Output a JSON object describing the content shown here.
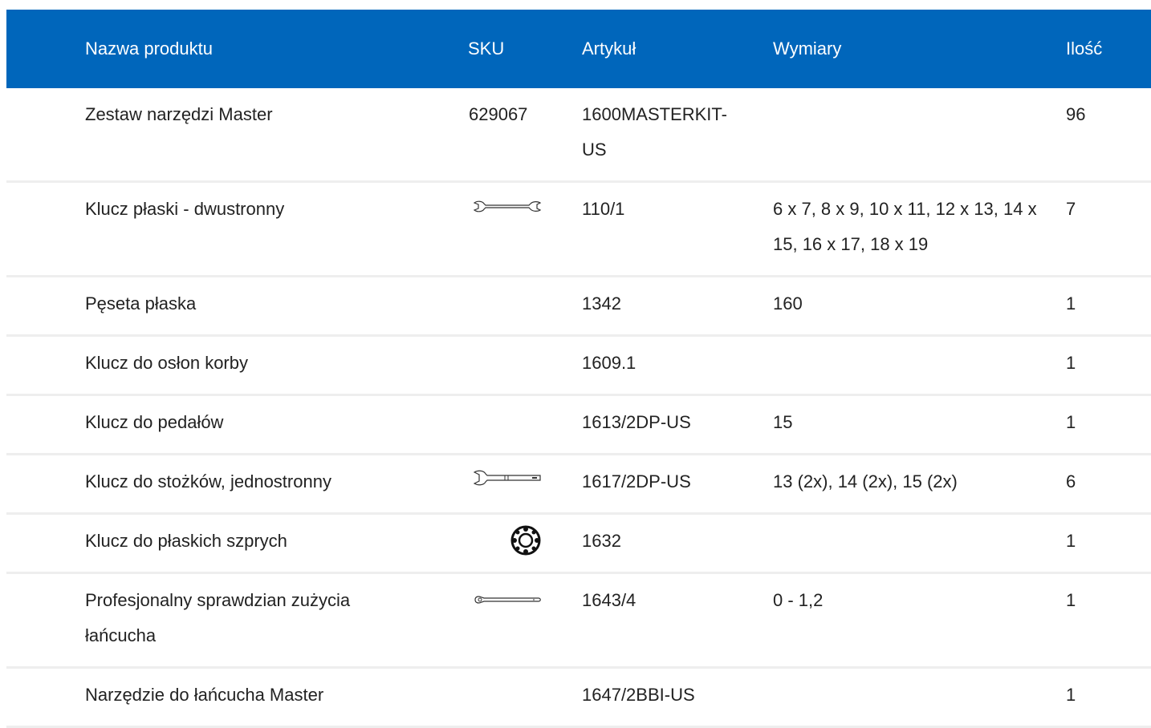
{
  "headers": {
    "name": "Nazwa produktu",
    "sku": "SKU",
    "article": "Artykuł",
    "dimensions": "Wymiary",
    "qty": "Ilość"
  },
  "rows": [
    {
      "name": "Zestaw narzędzi Master",
      "sku": "629067",
      "icon": "",
      "article": "1600MASTERKIT-US",
      "dimensions": "",
      "qty": "96"
    },
    {
      "name": "Klucz płaski - dwustronny",
      "sku": "",
      "icon": "double-open-wrench-icon",
      "article": "110/1",
      "dimensions": "6 x 7, 8 x 9, 10 x 11, 12 x 13, 14 x 15, 16 x 17, 18 x 19",
      "qty": "7"
    },
    {
      "name": "Pęseta płaska",
      "sku": "",
      "icon": "",
      "article": "1342",
      "dimensions": "160",
      "qty": "1"
    },
    {
      "name": "Klucz do osłon korby",
      "sku": "",
      "icon": "",
      "article": "1609.1",
      "dimensions": "",
      "qty": "1"
    },
    {
      "name": "Klucz do pedałów",
      "sku": "",
      "icon": "",
      "article": "1613/2DP-US",
      "dimensions": "15",
      "qty": "1"
    },
    {
      "name": "Klucz do stożków, jednostronny",
      "sku": "",
      "icon": "cone-wrench-icon",
      "article": "1617/2DP-US",
      "dimensions": "13 (2x), 14 (2x), 15 (2x)",
      "qty": "6"
    },
    {
      "name": "Klucz do płaskich szprych",
      "sku": "",
      "icon": "spoke-wrench-icon",
      "article": "1632",
      "dimensions": "",
      "qty": "1"
    },
    {
      "name": "Profesjonalny sprawdzian zużycia łańcucha",
      "sku": "",
      "icon": "chain-checker-icon",
      "article": "1643/4",
      "dimensions": "0 - 1,2",
      "qty": "1"
    },
    {
      "name": "Narzędzie do łańcucha Master",
      "sku": "",
      "icon": "",
      "article": "1647/2BBI-US",
      "dimensions": "",
      "qty": "1"
    }
  ]
}
